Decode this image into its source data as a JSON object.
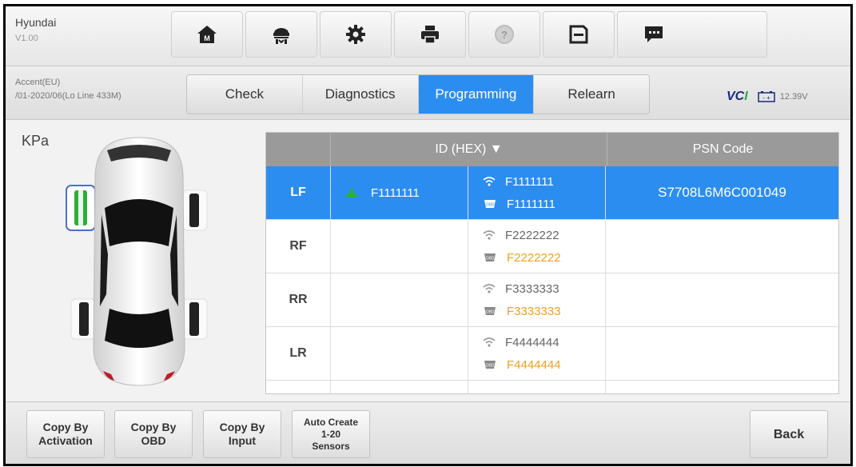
{
  "header": {
    "app_title": "Hyundai",
    "version": "V1.00",
    "toolbar": [
      {
        "icon": "home-icon"
      },
      {
        "icon": "vehicle-lift-icon"
      },
      {
        "icon": "gear-icon"
      },
      {
        "icon": "printer-icon"
      },
      {
        "icon": "help-icon"
      },
      {
        "icon": "save-icon"
      },
      {
        "icon": "message-icon"
      }
    ]
  },
  "vehicle": {
    "model": "Accent(EU)",
    "range": "/01-2020/06(Lo Line 433M)"
  },
  "tabs": [
    {
      "label": "Check",
      "active": false
    },
    {
      "label": "Diagnostics",
      "active": false
    },
    {
      "label": "Programming",
      "active": true
    },
    {
      "label": "Relearn",
      "active": false
    }
  ],
  "status": {
    "vci": "VCI",
    "voltage": "12.39V"
  },
  "unit": "KPa",
  "table": {
    "headers": {
      "id": "ID (HEX) ▼",
      "psn": "PSN Code"
    },
    "rows": [
      {
        "pos": "LF",
        "hex": "F1111111",
        "wireless": "F1111111",
        "obd": "F1111111",
        "psn": "S7708L6M6C001049",
        "selected": true
      },
      {
        "pos": "RF",
        "hex": "",
        "wireless": "F2222222",
        "obd": "F2222222",
        "psn": ""
      },
      {
        "pos": "RR",
        "hex": "",
        "wireless": "F3333333",
        "obd": "F3333333",
        "psn": ""
      },
      {
        "pos": "LR",
        "hex": "",
        "wireless": "F4444444",
        "obd": "F4444444",
        "psn": ""
      }
    ]
  },
  "buttons": {
    "copy_activation": [
      "Copy By",
      "Activation"
    ],
    "copy_obd": [
      "Copy By",
      "OBD"
    ],
    "copy_input": [
      "Copy By",
      "Input"
    ],
    "auto_create": [
      "Auto Create",
      "1-20",
      "Sensors"
    ],
    "back": "Back"
  },
  "colors": {
    "accent": "#2c8df0",
    "obd_value": "#f0a020",
    "active_sensor": "#2cae3c"
  }
}
